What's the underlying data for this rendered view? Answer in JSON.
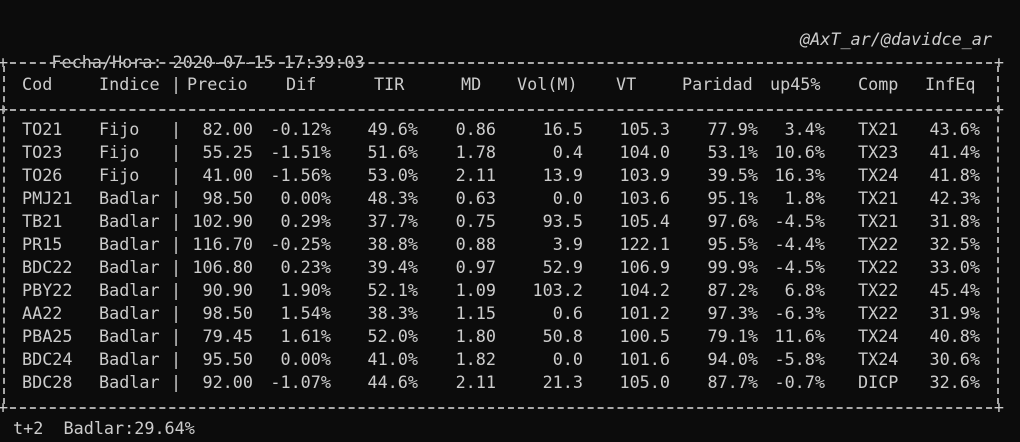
{
  "header": {
    "datetime": "Fecha/Hora: 2020-07-15 17:39:03",
    "credit": "@AxT_ar/@davidce_ar"
  },
  "columns": [
    "Cod",
    "Indice",
    "Precio",
    "Dif",
    "TIR",
    "MD",
    "Vol(M)",
    "VT",
    "Paridad",
    "up45%",
    "Comp",
    "InfEq"
  ],
  "rows": [
    [
      "TO21",
      "Fijo",
      "82.00",
      "-0.12%",
      "49.6%",
      "0.86",
      "16.5",
      "105.3",
      "77.9%",
      "3.4%",
      "TX21",
      "43.6%"
    ],
    [
      "TO23",
      "Fijo",
      "55.25",
      "-1.51%",
      "51.6%",
      "1.78",
      "0.4",
      "104.0",
      "53.1%",
      "10.6%",
      "TX23",
      "41.4%"
    ],
    [
      "TO26",
      "Fijo",
      "41.00",
      "-1.56%",
      "53.0%",
      "2.11",
      "13.9",
      "103.9",
      "39.5%",
      "16.3%",
      "TX24",
      "41.8%"
    ],
    [
      "PMJ21",
      "Badlar",
      "98.50",
      "0.00%",
      "48.3%",
      "0.63",
      "0.0",
      "103.6",
      "95.1%",
      "1.8%",
      "TX21",
      "42.3%"
    ],
    [
      "TB21",
      "Badlar",
      "102.90",
      "0.29%",
      "37.7%",
      "0.75",
      "93.5",
      "105.4",
      "97.6%",
      "-4.5%",
      "TX21",
      "31.8%"
    ],
    [
      "PR15",
      "Badlar",
      "116.70",
      "-0.25%",
      "38.8%",
      "0.88",
      "3.9",
      "122.1",
      "95.5%",
      "-4.4%",
      "TX22",
      "32.5%"
    ],
    [
      "BDC22",
      "Badlar",
      "106.80",
      "0.23%",
      "39.4%",
      "0.97",
      "52.9",
      "106.9",
      "99.9%",
      "-4.5%",
      "TX22",
      "33.0%"
    ],
    [
      "PBY22",
      "Badlar",
      "90.90",
      "1.90%",
      "52.1%",
      "1.09",
      "103.2",
      "104.2",
      "87.2%",
      "6.8%",
      "TX22",
      "45.4%"
    ],
    [
      "AA22",
      "Badlar",
      "98.50",
      "1.54%",
      "38.3%",
      "1.15",
      "0.6",
      "101.2",
      "97.3%",
      "-6.3%",
      "TX22",
      "31.9%"
    ],
    [
      "PBA25",
      "Badlar",
      "79.45",
      "1.61%",
      "52.0%",
      "1.80",
      "50.8",
      "100.5",
      "79.1%",
      "11.6%",
      "TX24",
      "40.8%"
    ],
    [
      "BDC24",
      "Badlar",
      "95.50",
      "0.00%",
      "41.0%",
      "1.82",
      "0.0",
      "101.6",
      "94.0%",
      "-5.8%",
      "TX24",
      "30.6%"
    ],
    [
      "BDC28",
      "Badlar",
      "92.00",
      "-1.07%",
      "44.6%",
      "2.11",
      "21.3",
      "105.0",
      "87.7%",
      "-0.7%",
      "DICP",
      "32.6%"
    ]
  ],
  "footer": "t+2  Badlar:29.64%"
}
